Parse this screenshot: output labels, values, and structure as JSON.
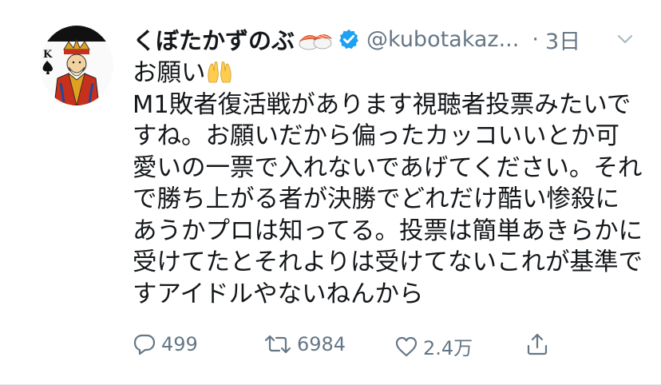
{
  "tweet": {
    "author_name": "くぼたかずのぶ",
    "handle": "@kubotakaz...",
    "separator": "·",
    "time": "3日",
    "text_prefix": "お願い",
    "text_body": "M1敗者復活戦があります視聴者投票みたいですね。お願いだから偏ったカッコいいとか可愛いの一票で入れないであげてください。それで勝ち上がる者が決勝でどれだけ酷い惨殺にあうかプロは知ってる。投票は簡単あきらかに受けてたとそれよりは受けてないこれが基準ですアイドルやないねんから"
  },
  "actions": {
    "reply_count": "499",
    "retweet_count": "6984",
    "like_count": "2.4万"
  },
  "icons": {
    "avatar": "king-of-spades-card-avatar",
    "name_emoji": "sushi-icon",
    "verified": "verified-badge-icon",
    "caret": "chevron-down-icon",
    "text_emoji": "raised-hands-icon",
    "reply": "reply-icon",
    "retweet": "retweet-icon",
    "like": "heart-icon",
    "share": "share-icon"
  },
  "colors": {
    "verified": "#1da1f2",
    "secondary_text": "#657786",
    "primary_text": "#14171a"
  }
}
